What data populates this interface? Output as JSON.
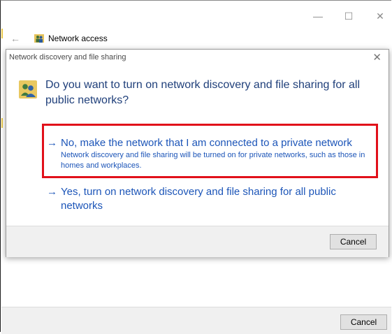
{
  "window": {
    "minimize_glyph": "—",
    "maximize_glyph": "☐",
    "close_glyph": "✕",
    "back_glyph": "←",
    "title": "Network access",
    "cancel_label": "Cancel"
  },
  "dialog": {
    "title": "Network discovery and file sharing",
    "close_glyph": "✕",
    "question": "Do you want to turn on network discovery and file sharing for all public networks?",
    "arrow_glyph": "→",
    "options": [
      {
        "label": "No, make the network that I am connected to a private network",
        "description": "Network discovery and file sharing will be turned on for private networks, such as those in homes and workplaces."
      },
      {
        "label": "Yes, turn on network discovery and file sharing for all public networks",
        "description": ""
      }
    ],
    "cancel_label": "Cancel"
  },
  "colors": {
    "link_blue": "#1c55b8",
    "question_blue": "#1f3f7a",
    "highlight_red": "#e1101a"
  }
}
